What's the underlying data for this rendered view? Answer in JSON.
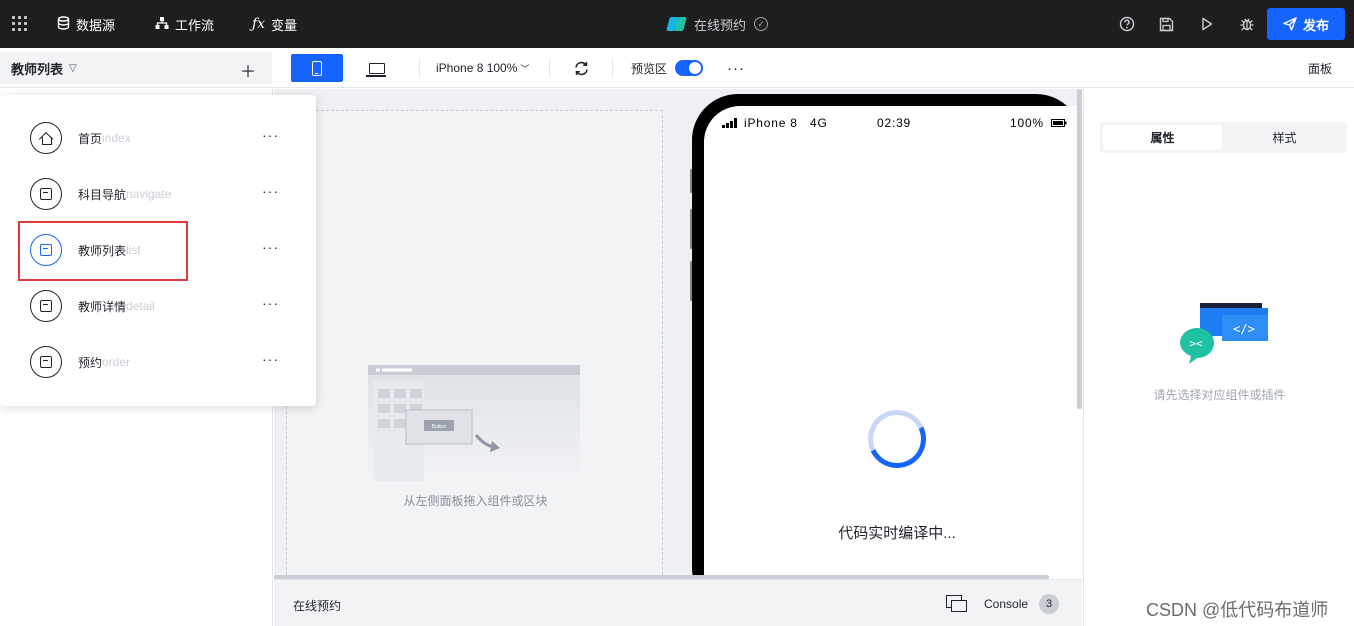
{
  "topbar": {
    "nav": [
      {
        "label": "数据源",
        "icon": "database-icon"
      },
      {
        "label": "工作流",
        "icon": "workflow-icon"
      },
      {
        "label": "变量",
        "icon": "function-icon"
      }
    ],
    "app_title": "在线预约",
    "publish_label": "发布"
  },
  "toolbar": {
    "current_page": "教师列表",
    "device_label": "iPhone 8 100%",
    "preview_label": "预览区",
    "preview_enabled": true,
    "panel_label": "面板"
  },
  "pages": [
    {
      "name": "首页",
      "slug": "index",
      "icon": "home-icon"
    },
    {
      "name": "科目导航",
      "slug": "navigate",
      "icon": "page-icon"
    },
    {
      "name": "教师列表",
      "slug": "list",
      "icon": "page-icon",
      "selected": true
    },
    {
      "name": "教师详情",
      "slug": "detail",
      "icon": "page-icon"
    },
    {
      "name": "预约",
      "slug": "order",
      "icon": "page-icon"
    }
  ],
  "canvas": {
    "drop_hint": "从左侧面板拖入组件或区块",
    "illustration_button": "Button",
    "phone_status": {
      "carrier": "iPhone 8",
      "network": "4G",
      "time": "02:39",
      "battery": "100%"
    },
    "loading_text": "代码实时编译中..."
  },
  "bottom": {
    "breadcrumb": "在线预约",
    "console_label": "Console",
    "console_count": "3"
  },
  "right_panel": {
    "tabs": [
      "属性",
      "样式"
    ],
    "active_tab": 0,
    "empty_text": "请先选择对应组件或插件"
  },
  "watermark": "CSDN @低代码布道师",
  "colors": {
    "accent": "#1664ff",
    "topbar": "#1e1e1e",
    "highlight": "#e03c3c"
  }
}
